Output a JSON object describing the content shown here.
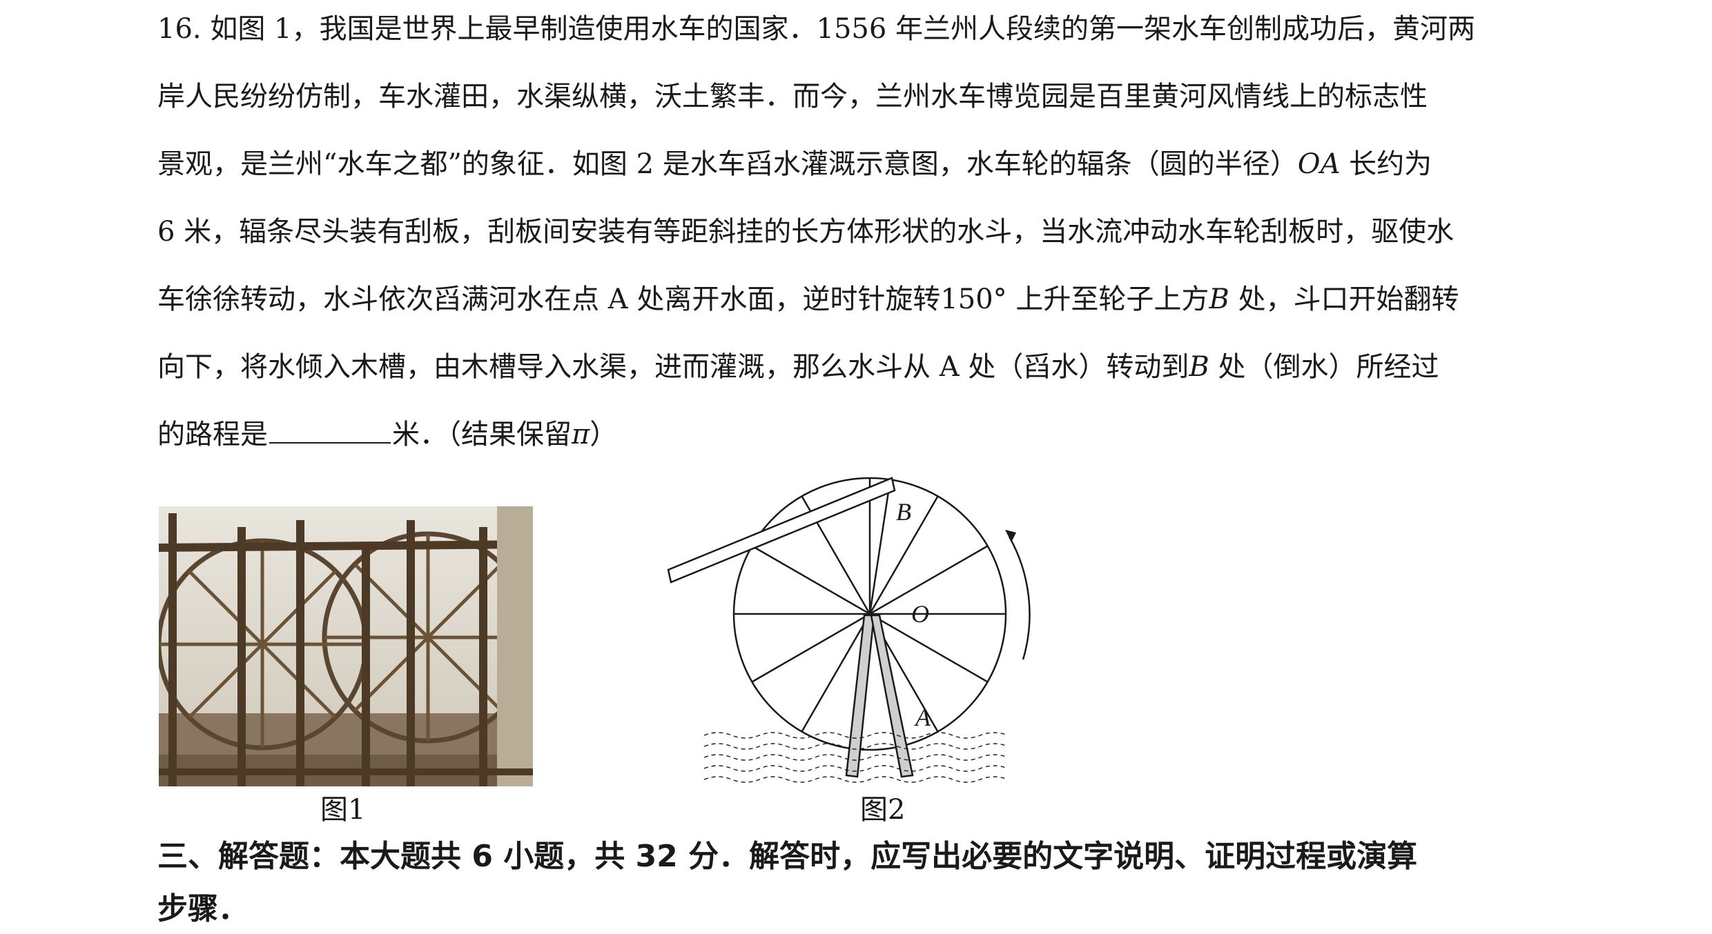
{
  "question": {
    "lines": [
      "16. 如图 1，我国是世界上最早制造使用水车的国家．1556 年兰州人段续的第一架水车创制成功后，黄河两",
      "岸人民纷纷仿制，车水灌田，水渠纵横，沃土繁丰．而今，兰州水车博览园是百里黄河风情线上的标志性",
      "景观，是兰州“水车之都”的象征．如图 2 是水车舀水灌溉示意图，水车轮的辐条（圆的半径）",
      "6 米，辐条尽头装有刮板，刮板间安装有等距斜挂的长方体形状的水斗，当水流冲动水车轮刮板时，驱使水",
      "车徐徐转动，水斗依次舀满河水在点 A 处离开水面，逆时针旋转150° 上升至轮子上方",
      "向下，将水倾入木槽，由木槽导入水渠，进而灌溉，那么水斗从 A 处（舀水）转动到",
      "的路程是"
    ],
    "oa_label": "OA",
    "line3_tail": " 长约为",
    "b_label": "B",
    "line5_tail": " 处，斗口开始翻转",
    "line6_tail": " 处（倒水）所经过",
    "line7_tail": "米．（结果保留",
    "pi": "π",
    "line7_end": "）"
  },
  "figures": {
    "fig1_caption": "图1",
    "fig2_caption": "图2",
    "label_A": "A",
    "label_B": "B",
    "label_O": "O"
  },
  "section": {
    "heading_line1": "三、解答题：本大题共 6 小题，共 32 分．解答时，应写出必要的文字说明、证明过程或演算",
    "heading_line2": "步骤．"
  }
}
